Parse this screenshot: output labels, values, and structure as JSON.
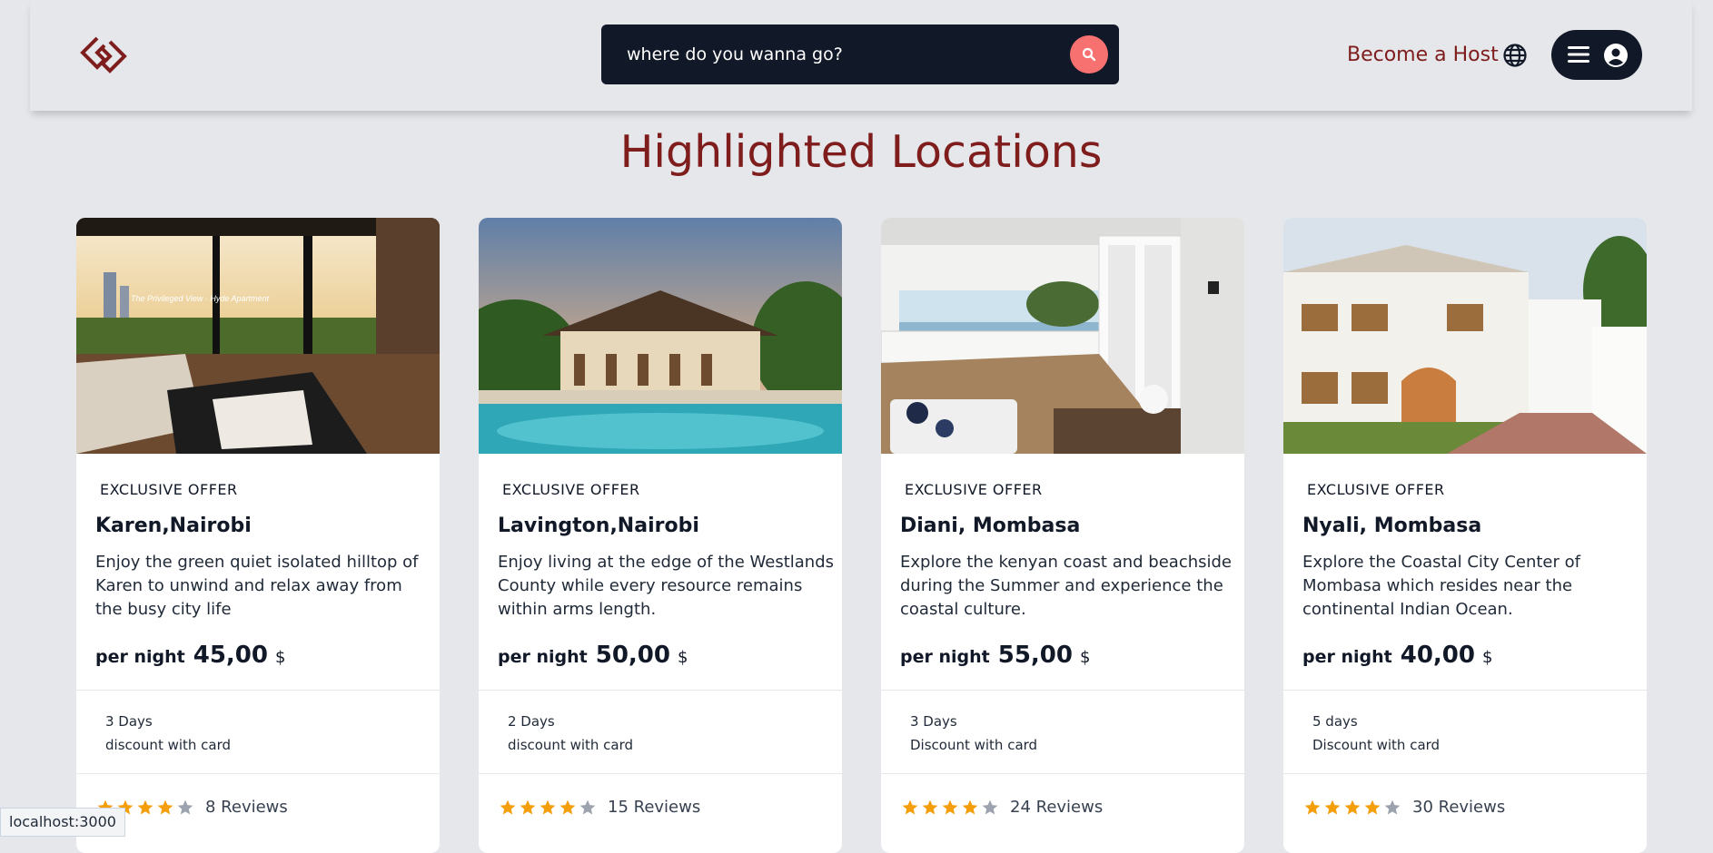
{
  "colors": {
    "brand": "#7f1d1d",
    "dark": "#111827",
    "search_button": "#f87171",
    "star": "#f59e0b",
    "star_empty": "#9ca3af"
  },
  "header": {
    "search_placeholder": "where do you wanna go?",
    "host_link": "Become a Host",
    "icons": [
      "logo-icon",
      "search-icon",
      "globe-icon",
      "menu-icon",
      "user-icon"
    ]
  },
  "main": {
    "title": "Highlighted Locations",
    "cards": [
      {
        "badge": "EXCLUSIVE OFFER",
        "title": "Karen,Nairobi",
        "description": "Enjoy the green quiet isolated hilltop of Karen to unwind and relax away from the busy city life",
        "per_night": "per night",
        "price": "45,00",
        "currency": "$",
        "days": "3 Days",
        "discount": "discount with card",
        "stars": 4,
        "reviews": "8 Reviews"
      },
      {
        "badge": "EXCLUSIVE OFFER",
        "title": "Lavington,Nairobi",
        "description": "Enjoy living at the edge of the Westlands County while every resource remains within arms length.",
        "per_night": "per night",
        "price": "50,00",
        "currency": "$",
        "days": "2 Days",
        "discount": "discount with card",
        "stars": 4,
        "reviews": "15 Reviews"
      },
      {
        "badge": "EXCLUSIVE OFFER",
        "title": "Diani, Mombasa",
        "description": "Explore the kenyan coast and beachside during the Summer and experience the coastal culture.",
        "per_night": "per night",
        "price": "55,00",
        "currency": "$",
        "days": "3 Days",
        "discount": "Discount with card",
        "stars": 4,
        "reviews": "24 Reviews"
      },
      {
        "badge": "EXCLUSIVE OFFER",
        "title": "Nyali, Mombasa",
        "description": "Explore the Coastal City Center of Mombasa which resides near the continental Indian Ocean.",
        "per_night": "per night",
        "price": "40,00",
        "currency": "$",
        "days": "5 days",
        "discount": "Discount with card",
        "stars": 4,
        "reviews": "30 Reviews"
      }
    ]
  },
  "status_bar": {
    "url": "localhost:3000"
  }
}
